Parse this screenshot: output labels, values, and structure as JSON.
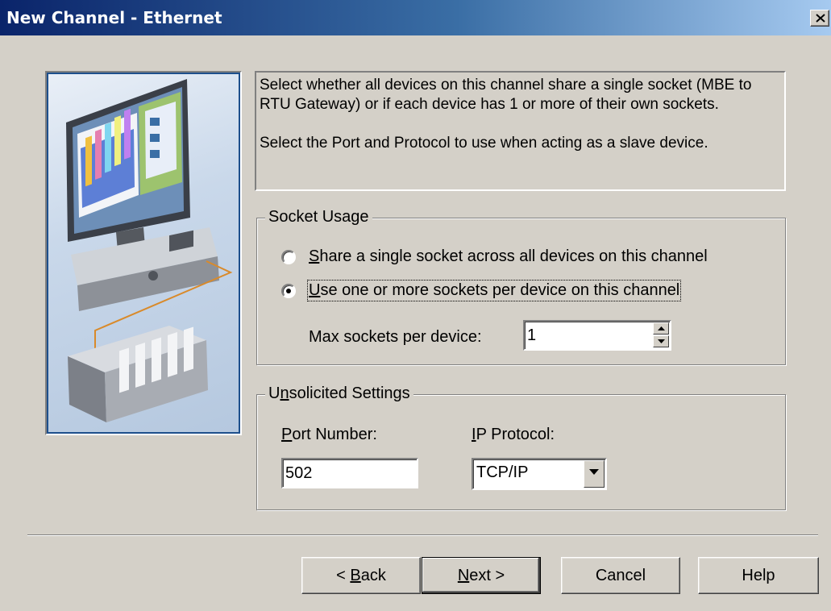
{
  "window": {
    "title": "New Channel - Ethernet"
  },
  "info": {
    "paragraph1": "Select whether all devices on this channel share a single socket (MBE to RTU Gateway) or if each device has 1 or more of their own sockets.",
    "paragraph2": "Select the Port and Protocol to use when acting as a slave device."
  },
  "socket_usage": {
    "legend": "Socket Usage",
    "option_share": {
      "prefix": "S",
      "rest": "hare a single socket across all devices on this channel",
      "selected": false
    },
    "option_per_device": {
      "prefix": "U",
      "rest": "se one or more sockets per device on this channel",
      "selected": true
    },
    "max_sockets_label": "Max sockets per device:",
    "max_sockets_value": "1"
  },
  "unsolicited": {
    "legend_prefix": "U",
    "legend_underlined": "n",
    "legend_rest": "solicited Settings",
    "port_label_prefix": "P",
    "port_label_rest": "ort Number:",
    "port_value": "502",
    "protocol_label_prefix": "I",
    "protocol_label_rest": "P Protocol:",
    "protocol_value": "TCP/IP"
  },
  "buttons": {
    "back_prefix": "< ",
    "back_underlined": "B",
    "back_rest": "ack",
    "next_underlined": "N",
    "next_rest": "ext >",
    "cancel": "Cancel",
    "help": "Help"
  },
  "colors": {
    "title_gradient_start": "#0a246a",
    "title_gradient_end": "#a6caf0",
    "face": "#d4d0c8"
  }
}
